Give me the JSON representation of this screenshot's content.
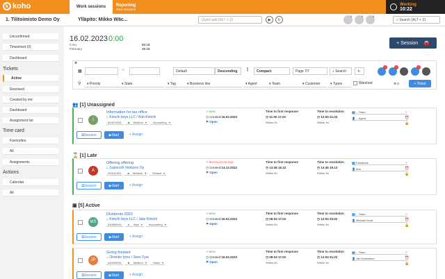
{
  "topbar": {
    "logo": "koho",
    "tabs": [
      {
        "label": "Work sessions",
        "sub": ""
      },
      {
        "label": "Reporting",
        "sub": "Own sessions"
      }
    ],
    "working_label": "Working",
    "working_time": "10:22"
  },
  "header": {
    "company": "1. Tilitoimisto Demo Oy",
    "maintenance": "Ylläpito: Mikko Wäc...",
    "quick_placeholder": "Quick add (ALT + Z)",
    "search_placeholder": "Search (ALT + Z)",
    "icon_counts": [
      "0",
      "0",
      "0"
    ]
  },
  "sidebar": {
    "top_items": [
      "Unconfirmed",
      "Timesheet (0)",
      "Dashboard"
    ],
    "tickets_head": "Tickets",
    "ticket_items": [
      "Active",
      "Resolved",
      "Created by me",
      "Dashboard",
      "Assignment list"
    ],
    "timecard_head": "Time card",
    "timecard_items": [
      "Favourites",
      "All",
      "Assignments"
    ],
    "actions_head": "Actions",
    "action_items": [
      "Calendar",
      "All"
    ]
  },
  "day": {
    "date": "16.02.2023",
    "timer": "0:00",
    "l1": "0 mo",
    "l2": "February",
    "v1": "83:18",
    "v2": "35:18"
  },
  "session_button": "+ Session",
  "filters": {
    "sort_field": "Default",
    "sort_dir": "Descending",
    "view": "Compact",
    "page": "Page 7/7",
    "search_label": "Search",
    "priority": "Priority",
    "state": "State",
    "tag": "Tag",
    "business_line": "Business line",
    "agent": "Agent",
    "team": "Team",
    "customer": "Customer",
    "types": "Types",
    "watched": "Watched",
    "count": "0",
    "ticket_btn": "+ Ticket",
    "badge_counts": [
      "1",
      "1",
      "1"
    ]
  },
  "sections": {
    "unassigned": "[1] Unassigned",
    "late": "[1] Late",
    "active": "[5] Active"
  },
  "cards": [
    {
      "initials": "I",
      "avatar_color": "#7aa06a",
      "title": "Information for tax office",
      "customer": "Kimchi boys LLC / Bob Kimchi",
      "num": "644570001",
      "priority": "Medium",
      "category": "Accounting",
      "status": "NEW",
      "status_color": "#2e9a3a",
      "created": "16.02.2023",
      "state": "Open",
      "tfr_label": "Time to first response",
      "tfr_val": "11:00 17.02",
      "tfr_within": "Within 9h",
      "ttr_label": "Time to resolution",
      "ttr_val": "12:00 21.02",
      "ttr_within": "Within 3d",
      "sel1": "-- Team",
      "sel2": "-- Agent"
    },
    {
      "initials": "A",
      "avatar_color": "#c0392b",
      "title": "Offering offering",
      "customer": "Supercell Ventures Oy",
      "num": "252111001",
      "priority": "Medium",
      "category": "Default",
      "status": "RESOLUTION DUE",
      "status_color": "#e33",
      "created": "14.12.2022",
      "state": "Open",
      "tfr_label": "Time to first response",
      "tfr_val": "13:46 15.12",
      "tfr_within": "Within 9h",
      "ttr_label": "Time to resolution",
      "ttr_val": "14:46 19.12",
      "ttr_within": "Within 3d",
      "sel1": "Facebook",
      "sel2": "Anu"
    },
    {
      "initials": "MS",
      "avatar_color": "#4fa58a",
      "title": "Dividends 2022",
      "customer": "Kimchi boys LLC / Jake Kimchi",
      "num": "644580001",
      "priority": "High",
      "category": "Accounting",
      "status": "NEW",
      "status_color": "#2e9a3a",
      "created": "16.02.2023",
      "state": "Open",
      "tfr_label": "Time to first response",
      "tfr_val": "08:04 17.02",
      "tfr_within": "Within 6h",
      "ttr_label": "Time to resolution",
      "ttr_val": "12:04 20.02",
      "ttr_within": "Within 3d",
      "sel1": "-- Team",
      "sel2": "Michael Scott"
    },
    {
      "initials": "JP",
      "avatar_color": "#e57e3b",
      "title": "Going forward",
      "customer": "Otombo tyres / Sven Tyre",
      "num": "644590001",
      "priority": "Medium",
      "category": "Sales",
      "status": "NEW",
      "status_color": "#2e9a3a",
      "created": "16.02.2023",
      "state": "Open",
      "tfr_label": "Time to first response",
      "tfr_val": "08:04 17.02",
      "tfr_within": "Within 6h",
      "ttr_label": "Time to resolution",
      "ttr_val": "12:04 21.02",
      "ttr_within": "Within 3d",
      "sel1": "-- Team",
      "sel2": "Jan Holmsteen"
    }
  ],
  "card_buttons": {
    "session": "Session",
    "start": "Start",
    "assign": "Assign"
  },
  "created_prefix": "Created:"
}
